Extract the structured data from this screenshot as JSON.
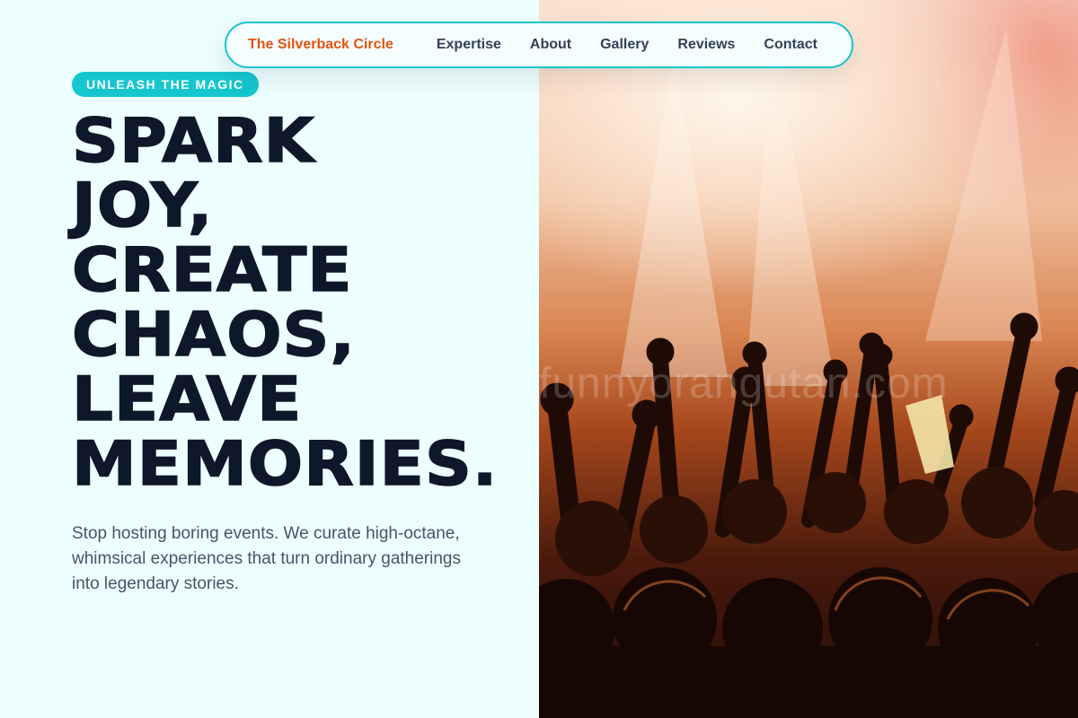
{
  "nav": {
    "brand": "The Silverback Circle",
    "links": [
      "Expertise",
      "About",
      "Gallery",
      "Reviews",
      "Contact"
    ]
  },
  "hero": {
    "badge": "UNLEASH THE MAGIC",
    "headline_lines": [
      "SPARK",
      "JOY,",
      "CREATE",
      "CHAOS,",
      "LEAVE",
      "MEMORIES."
    ],
    "subtext": "Stop hosting boring events. We curate high-octane, whimsical experiences that turn ordinary gatherings into legendary stories.",
    "image_watermark": "funnyorangutan.com"
  },
  "colors": {
    "background": "#ecfefe",
    "accent": "#15c6cf",
    "brand": "#e4520e",
    "text_dark": "#0f172a",
    "text_muted": "#475569"
  }
}
